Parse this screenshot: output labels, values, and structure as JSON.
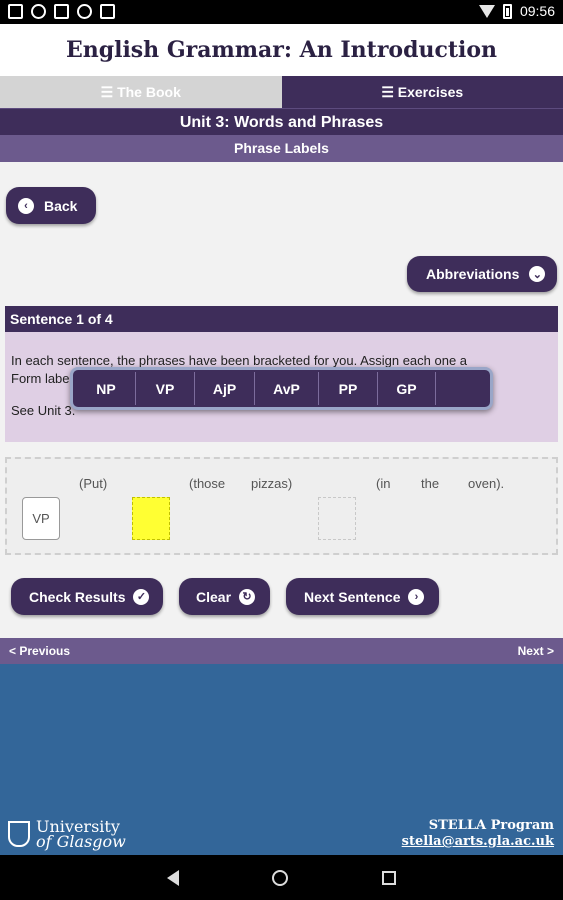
{
  "status_bar": {
    "time": "09:56"
  },
  "app": {
    "title": "English Grammar: An Introduction"
  },
  "tabs": [
    {
      "label": "The Book",
      "icon": "list-icon",
      "active": false
    },
    {
      "label": "Exercises",
      "icon": "list-icon",
      "active": true
    }
  ],
  "unit_title": "Unit 3: Words and Phrases",
  "section_title": "Phrase Labels",
  "buttons": {
    "back": "Back",
    "abbreviations": "Abbreviations",
    "check_results": "Check Results",
    "clear": "Clear",
    "next_sentence": "Next Sentence"
  },
  "sentence": {
    "header": "Sentence 1 of 4",
    "instruction_line1": "In each sentence, the phrases have been bracketed for you. Assign each one a",
    "instruction_line2": "Form label.",
    "instruction_line3": "See Unit 3.",
    "words": [
      "(Put)",
      "(those",
      "pizzas)",
      "(in",
      "the",
      "oven)."
    ],
    "assigned_label": "VP"
  },
  "popup": {
    "options": [
      "NP",
      "VP",
      "AjP",
      "AvP",
      "PP",
      "GP",
      ""
    ]
  },
  "nav": {
    "previous": "< Previous",
    "next": "Next >"
  },
  "footer": {
    "university_line1": "University",
    "university_line2": "of Glasgow",
    "program": "STELLA Program",
    "email": "stella@arts.gla.ac.uk"
  },
  "colors": {
    "primary": "#3e2d5a",
    "secondary": "#6c5a8d",
    "instruction_bg": "#dfcfe4",
    "footer_bg": "#336699",
    "highlight": "#ffff33"
  }
}
